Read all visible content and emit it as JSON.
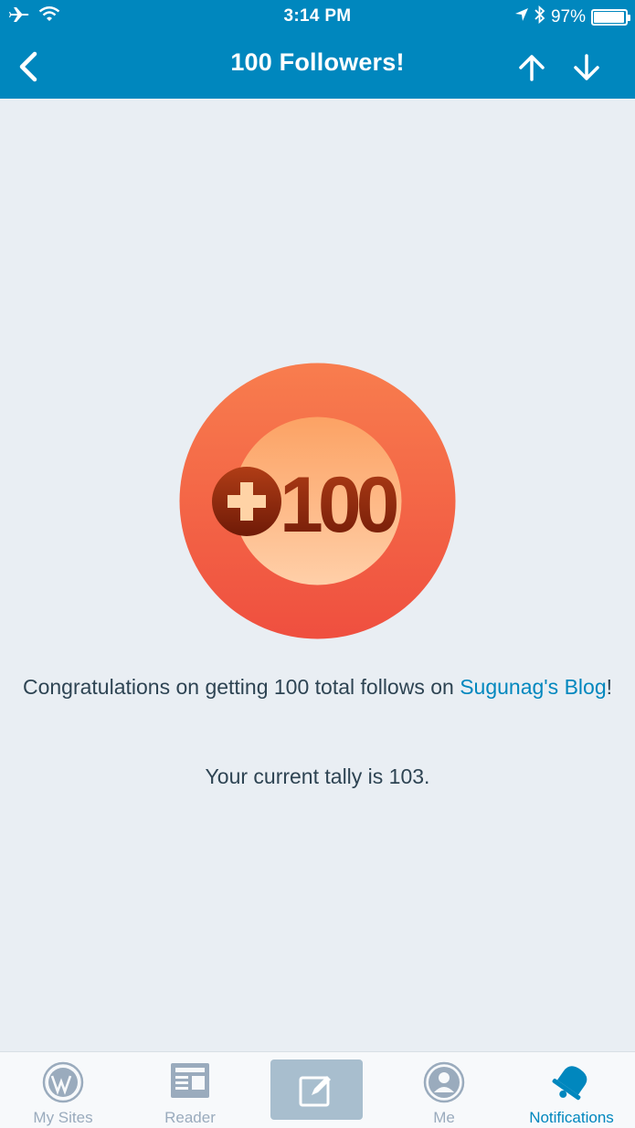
{
  "status_bar": {
    "time": "3:14 PM",
    "battery_percent": "97%",
    "battery_level": 0.97,
    "icons": [
      "airplane-icon",
      "wifi-icon",
      "location-arrow-icon",
      "bluetooth-icon",
      "battery-icon"
    ]
  },
  "nav": {
    "title": "100 Followers!",
    "back_icon": "chevron-left-icon",
    "prev_icon": "arrow-up-icon",
    "next_icon": "arrow-down-icon"
  },
  "badge": {
    "text": "100",
    "icon": "plus-circle-icon"
  },
  "message": {
    "prefix": "Congratulations on getting 100 total follows on ",
    "link": "Sugunag's Blog",
    "suffix": "!"
  },
  "tally": "Your current tally is 103.",
  "tabbar": {
    "items": [
      {
        "label": "My Sites",
        "icon": "wordpress-icon"
      },
      {
        "label": "Reader",
        "icon": "reader-icon"
      },
      {
        "label": "",
        "icon": "compose-icon"
      },
      {
        "label": "Me",
        "icon": "user-icon"
      },
      {
        "label": "Notifications",
        "icon": "bell-icon"
      }
    ],
    "active": "Notifications"
  },
  "colors": {
    "brand_blue": "#0087be",
    "background": "#e9eef3",
    "tab_inactive": "#9aabbd",
    "text": "#2e4453"
  }
}
